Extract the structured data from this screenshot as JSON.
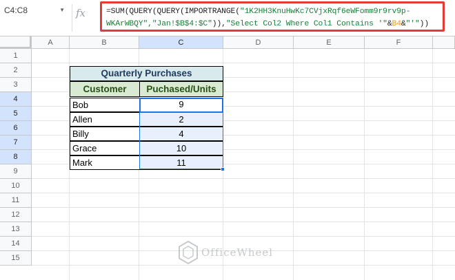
{
  "formula_bar": {
    "name_box": "C4:C8",
    "fx_label": "fx",
    "formula_parts": [
      {
        "t": "=SUM(QUERY(QUERY(IMPORTRANGE(",
        "c": "n"
      },
      {
        "t": "\"1K2HH3KnuHwKc7CVjxRqf6eWFomm9r9rv9p-",
        "c": "s"
      },
      {
        "t": "\n",
        "c": "n"
      },
      {
        "t": "WKArWBQY\",\"Jan!$B$4:$C\"",
        "c": "s"
      },
      {
        "t": ")),",
        "c": "n"
      },
      {
        "t": "\"Select Col2 Where Col1 Contains '\"",
        "c": "s"
      },
      {
        "t": "&",
        "c": "n"
      },
      {
        "t": "B4",
        "c": "r"
      },
      {
        "t": "&",
        "c": "n"
      },
      {
        "t": "\"'\"",
        "c": "s"
      },
      {
        "t": "))",
        "c": "n"
      }
    ]
  },
  "columns": [
    "A",
    "B",
    "C",
    "D",
    "E",
    "F"
  ],
  "rows": [
    "1",
    "2",
    "3",
    "4",
    "5",
    "6",
    "7",
    "8",
    "9",
    "10",
    "11",
    "12",
    "13",
    "14",
    "15"
  ],
  "table": {
    "title": "Quarterly Purchases",
    "headers": [
      "Customer",
      "Puchased/Units"
    ],
    "rows": [
      {
        "customer": "Bob",
        "units": "9"
      },
      {
        "customer": "Allen",
        "units": "2"
      },
      {
        "customer": "Billy",
        "units": "4"
      },
      {
        "customer": "Grace",
        "units": "10"
      },
      {
        "customer": "Mark",
        "units": "11"
      }
    ]
  },
  "watermark": {
    "text": "OfficeWheel"
  }
}
